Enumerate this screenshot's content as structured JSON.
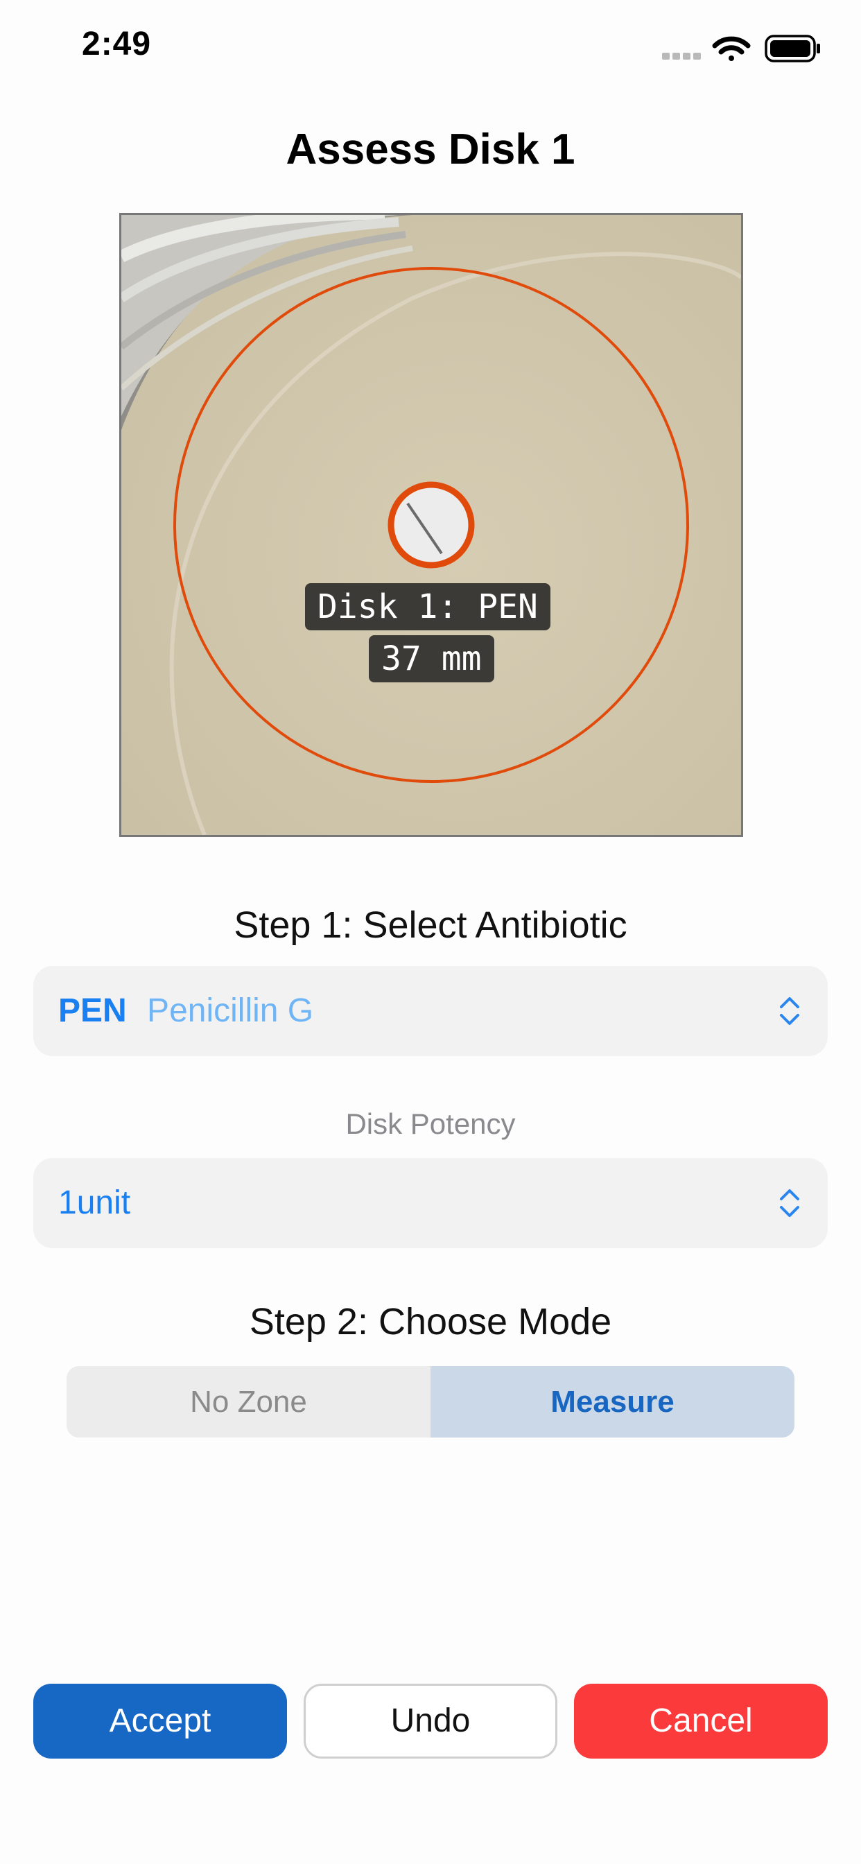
{
  "status_bar": {
    "time": "2:49",
    "icons": [
      "signal-icon",
      "wifi-icon",
      "battery-icon"
    ]
  },
  "header": {
    "title": "Assess Disk 1"
  },
  "image": {
    "label_line1": "Disk 1: PEN",
    "label_line2": "37 mm",
    "accent_color": "#e04a0a"
  },
  "step1": {
    "title": "Step 1: Select Antibiotic",
    "antibiotic_code": "PEN",
    "antibiotic_name": "Penicillin G",
    "potency_label": "Disk Potency",
    "potency_value": "1unit"
  },
  "step2": {
    "title": "Step 2: Choose Mode",
    "options": [
      "No Zone",
      "Measure"
    ],
    "selected": "Measure"
  },
  "buttons": {
    "accept": "Accept",
    "undo": "Undo",
    "cancel": "Cancel"
  },
  "colors": {
    "primary": "#1767c5",
    "danger": "#fb3a3c",
    "link": "#1a7ff0"
  }
}
